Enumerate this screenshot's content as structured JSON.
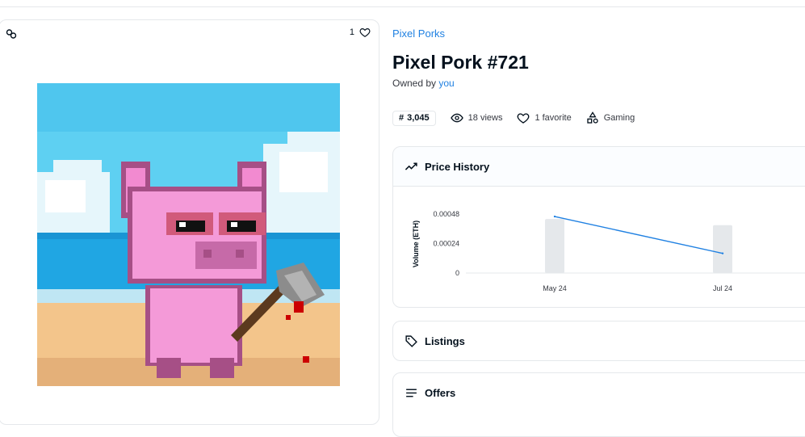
{
  "media": {
    "favorite_count": "1"
  },
  "collection": {
    "name": "Pixel Porks"
  },
  "item": {
    "title": "Pixel Pork #721",
    "owned_prefix": "Owned by",
    "owner": "you"
  },
  "stats": {
    "rank": "3,045",
    "rank_symbol": "#",
    "views": "18 views",
    "favorites": "1 favorite",
    "category": "Gaming"
  },
  "panels": {
    "price_history": "Price History",
    "listings": "Listings",
    "offers": "Offers"
  },
  "chart_data": {
    "type": "bar",
    "ylabel": "Volume (ETH)",
    "xlabel": "",
    "title": "",
    "categories": [
      "May 24",
      "Jul 24"
    ],
    "x_ticks": [
      "May 24",
      "Jul 24"
    ],
    "y_ticks": [
      "0.00048",
      "0.00024",
      "0"
    ],
    "ylim": [
      0,
      0.00048
    ],
    "series": [
      {
        "type": "bar",
        "values": [
          0.00044,
          0.00039
        ]
      },
      {
        "type": "line",
        "values": [
          0.00046,
          0.00016
        ]
      }
    ],
    "grid": false,
    "colors": {
      "bar": "#e5e8eb",
      "line": "#2081e2"
    }
  },
  "colors": {
    "accent": "#2081e2",
    "border": "#e5e8eb",
    "text": "#04111d"
  }
}
